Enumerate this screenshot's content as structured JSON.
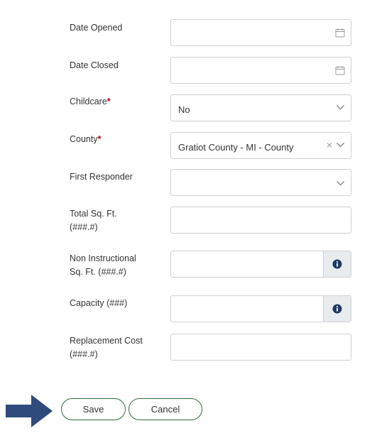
{
  "fields": {
    "date_opened": {
      "label": "Date Opened",
      "value": ""
    },
    "date_closed": {
      "label": "Date Closed",
      "value": ""
    },
    "childcare": {
      "label": "Childcare",
      "required_mark": "*",
      "value": "No"
    },
    "county": {
      "label": "County",
      "required_mark": "*",
      "value": "Gratiot County - MI - County",
      "clear_glyph": "×"
    },
    "first_responder": {
      "label": "First Responder",
      "value": ""
    },
    "total_sqft": {
      "label_line1": "Total Sq. Ft.",
      "label_line2": "(###.#)",
      "value": ""
    },
    "non_instructional": {
      "label_line1": "Non Instructional",
      "label_line2": "Sq. Ft. (###.#)",
      "value": ""
    },
    "capacity": {
      "label": "Capacity (###)",
      "value": ""
    },
    "replacement_cost": {
      "label_line1": "Replacement Cost",
      "label_line2": "(###.#)",
      "value": ""
    }
  },
  "actions": {
    "save_label": "Save",
    "cancel_label": "Cancel"
  },
  "icons": {
    "date": "calendar-icon",
    "select": "chevron-down-icon",
    "clear": "close-icon",
    "info": "info-icon",
    "pointer": "arrow-right-icon"
  },
  "colors": {
    "button_border": "#2e6b3a",
    "arrow": "#2f4a7c",
    "required": "#c00000",
    "addon_bg": "#e9ecef",
    "info_icon": "#1f3a66"
  }
}
